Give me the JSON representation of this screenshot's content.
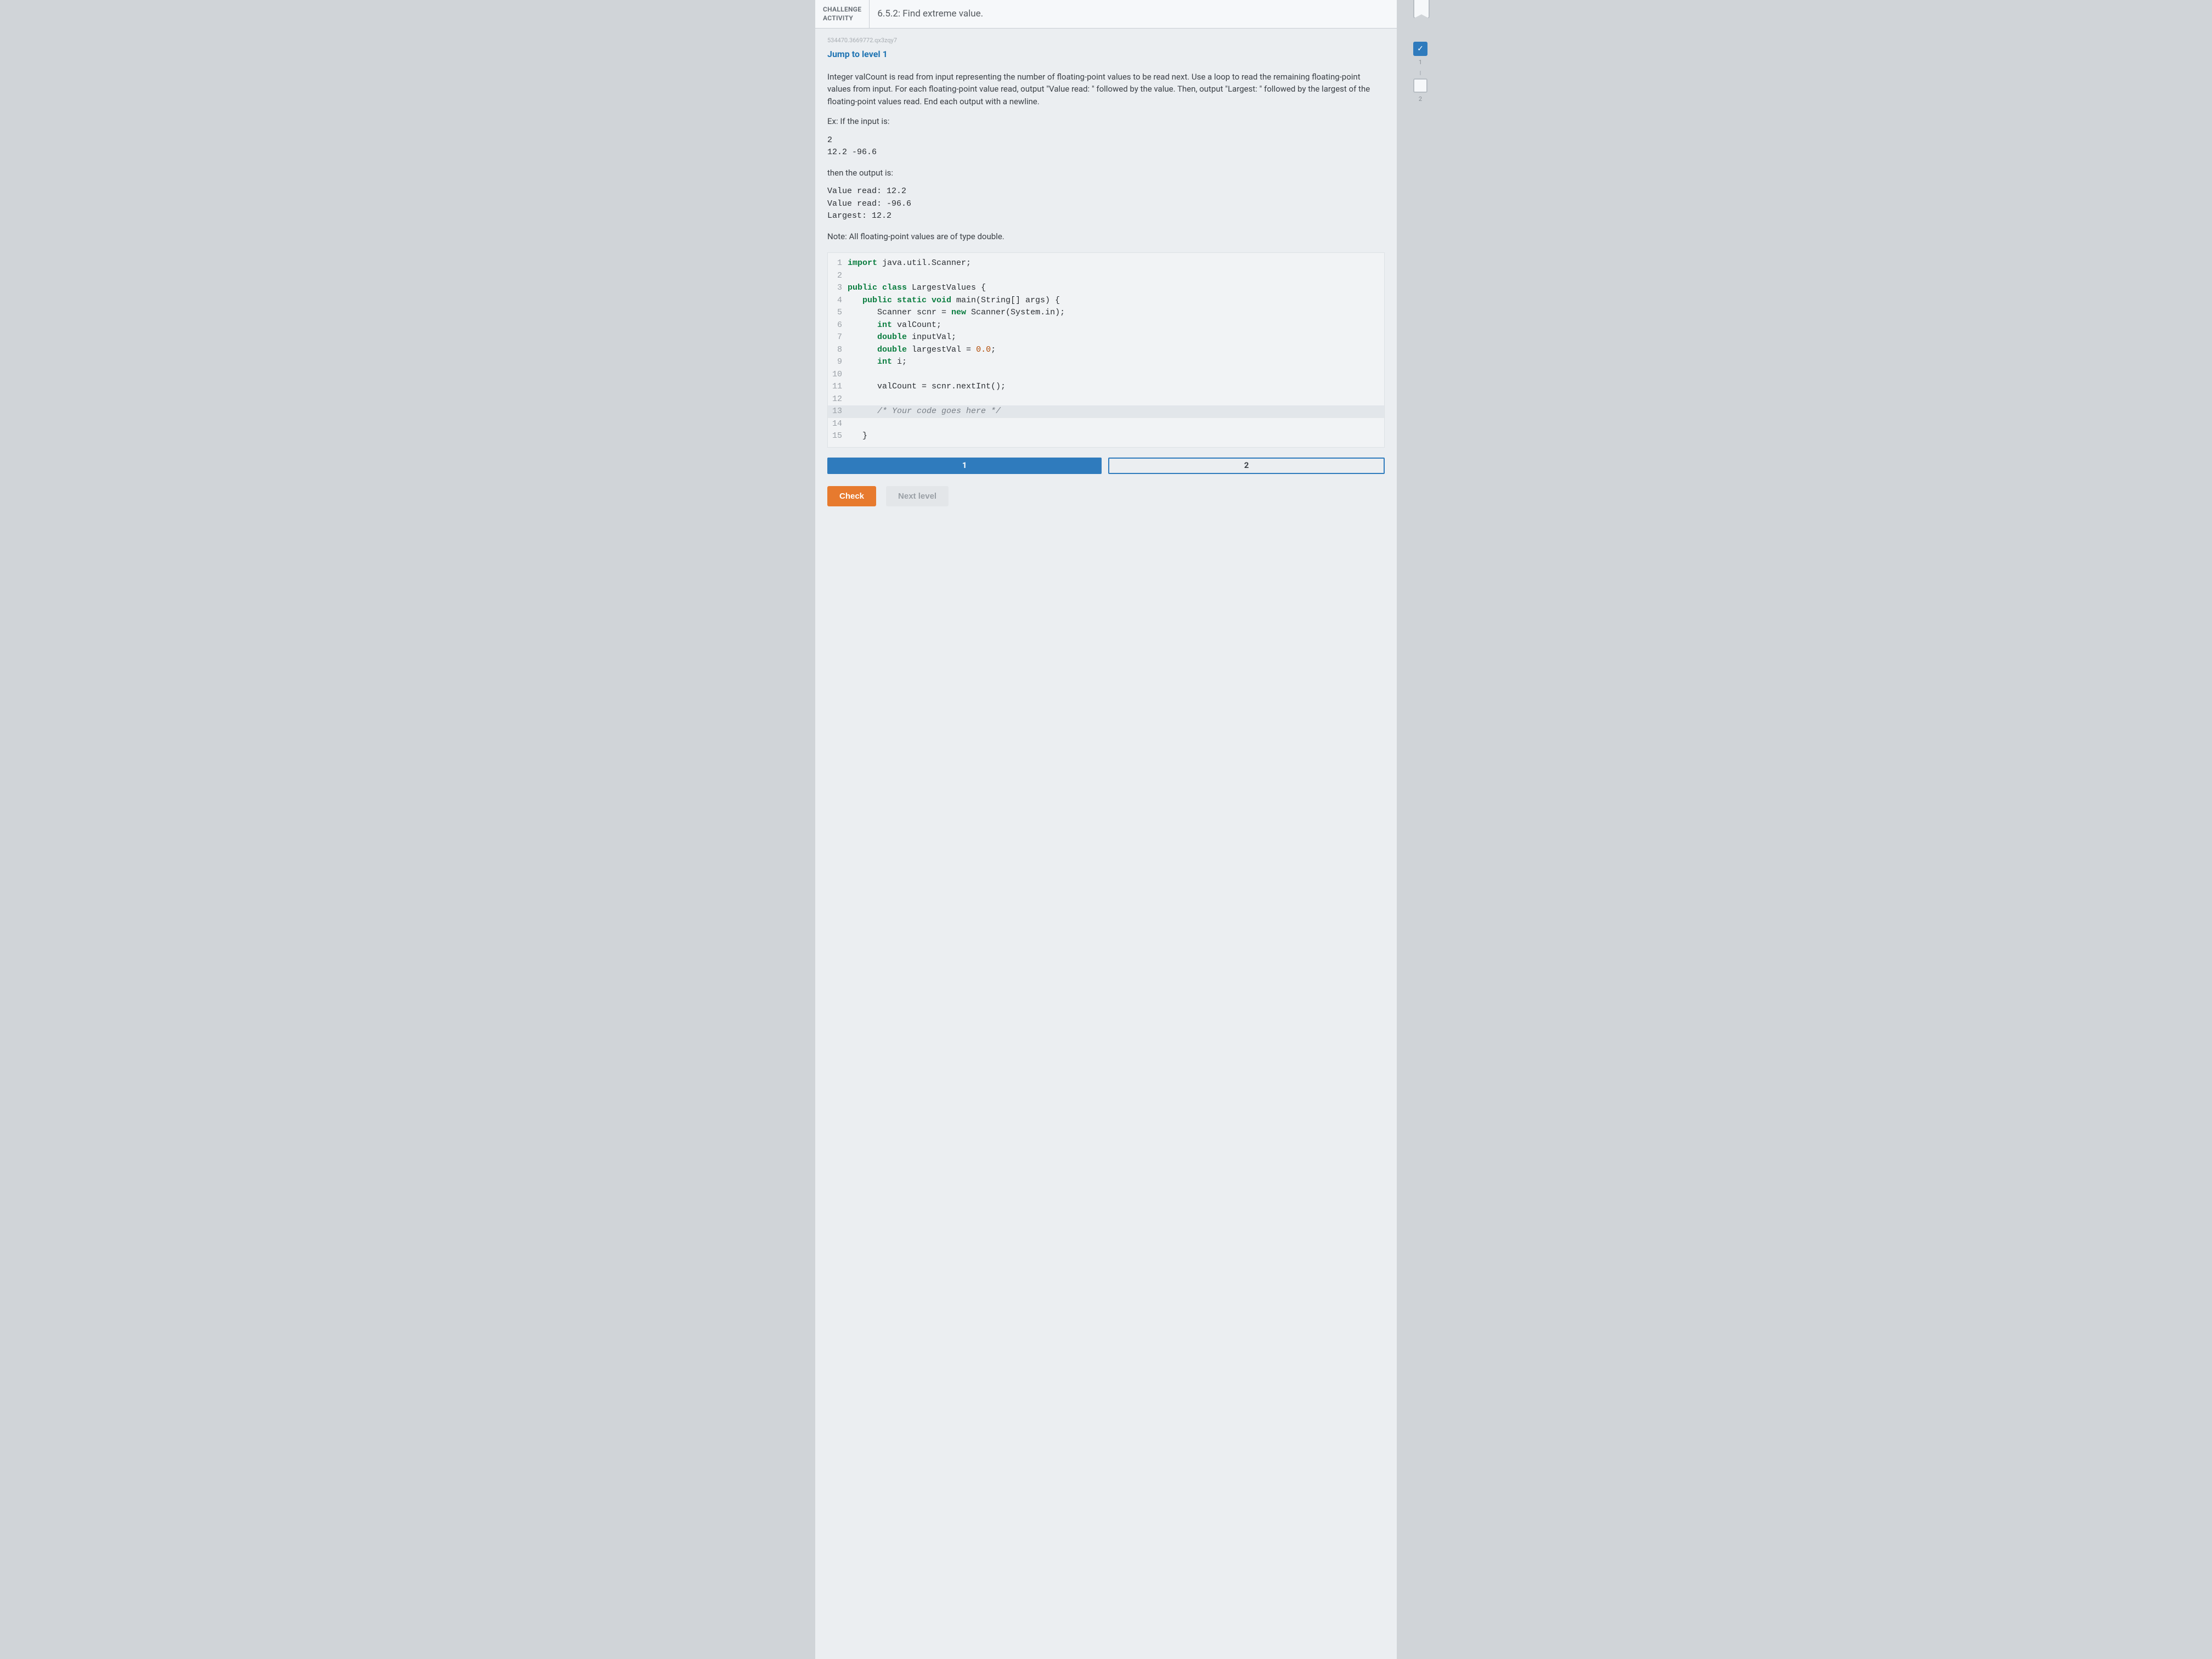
{
  "header": {
    "label": "CHALLENGE\nACTIVITY",
    "title": "6.5.2: Find extreme value."
  },
  "refid": "534470.3669772.qx3zqy7",
  "jump": "Jump to level 1",
  "instructions": "Integer valCount is read from input representing the number of floating-point values to be read next. Use a loop to read the remaining floating-point values from input. For each floating-point value read, output \"Value read: \" followed by the value. Then, output \"Largest: \" followed by the largest of the floating-point values read. End each output with a newline.",
  "example_label": "Ex: If the input is:",
  "example_input": "2\n12.2 -96.6",
  "then_label": "then the output is:",
  "example_output": "Value read: 12.2\nValue read: -96.6\nLargest: 12.2",
  "note": "Note: All floating-point values are of type double.",
  "code": {
    "lines": [
      {
        "n": "1",
        "t": "import",
        "rest": " java.util.Scanner;"
      },
      {
        "n": "2",
        "t": "",
        "rest": ""
      },
      {
        "n": "3",
        "t": "public class",
        "rest": " LargestValues {"
      },
      {
        "n": "4",
        "t": "   public static void",
        "rest": " main(String[] args) {"
      },
      {
        "n": "5",
        "t": "      Scanner scnr = ",
        "kw2": "new",
        "rest2": " Scanner(System.in);"
      },
      {
        "n": "6",
        "t": "      ",
        "kw2": "int",
        "rest2": " valCount;"
      },
      {
        "n": "7",
        "t": "      ",
        "kw2": "double",
        "rest2": " inputVal;"
      },
      {
        "n": "8",
        "t": "      ",
        "kw2": "double",
        "rest2": " largestVal = ",
        "num": "0.0",
        "rest3": ";"
      },
      {
        "n": "9",
        "t": "      ",
        "kw2": "int",
        "rest2": " i;"
      },
      {
        "n": "10",
        "t": "",
        "rest": ""
      },
      {
        "n": "11",
        "t": "      valCount = scnr.nextInt();",
        "rest": ""
      },
      {
        "n": "12",
        "t": "",
        "rest": ""
      },
      {
        "n": "13",
        "cmt": "      /* Your code goes here */"
      },
      {
        "n": "14",
        "t": "",
        "rest": ""
      },
      {
        "n": "15",
        "t": "   }",
        "rest": ""
      }
    ]
  },
  "levels": [
    "1",
    "2"
  ],
  "buttons": {
    "check": "Check",
    "next": "Next level"
  },
  "side": {
    "m1": "1",
    "m2": "2"
  }
}
